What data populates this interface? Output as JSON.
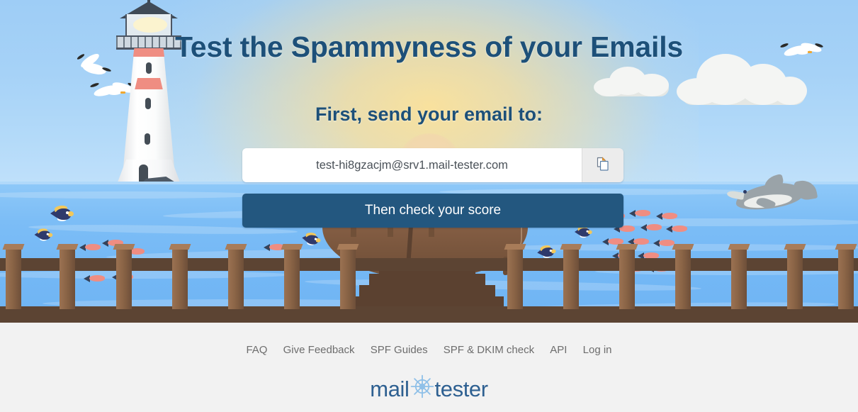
{
  "hero": {
    "title": "Test the Spammyness of your Emails",
    "subtitle": "First, send your email to:"
  },
  "form": {
    "email_value": "test-hi8gzacjm@srv1.mail-tester.com",
    "email_placeholder": "test-hi8gzacjm@srv1.mail-tester.com",
    "copy_icon": "copy-icon",
    "submit_label": "Then check your score"
  },
  "footer": {
    "links": [
      {
        "label": "FAQ"
      },
      {
        "label": "Give Feedback"
      },
      {
        "label": "SPF Guides"
      },
      {
        "label": "SPF & DKIM check"
      },
      {
        "label": "API"
      },
      {
        "label": "Log in"
      }
    ],
    "logo": {
      "part_one": "mail",
      "part_two": "tester",
      "icon": "ships-wheel-icon"
    }
  },
  "colors": {
    "brand_dark_blue": "#1d5079",
    "button_blue": "#23577f",
    "logo_blue": "#2e6091",
    "sky_blue": "#a6d2f7",
    "sea_blue": "#7cbdf6",
    "footer_gray": "#f2f2f2",
    "link_gray": "#6d6d6d",
    "lighthouse_red": "#ef8d82",
    "wood_brown": "#5c4433"
  },
  "scene": {
    "elements": [
      "lighthouse",
      "seagulls",
      "clouds",
      "sun-glow",
      "ocean",
      "fish-school",
      "tropical-fish",
      "dolphin",
      "rowboat",
      "dock-ramp",
      "wooden-railing"
    ]
  }
}
